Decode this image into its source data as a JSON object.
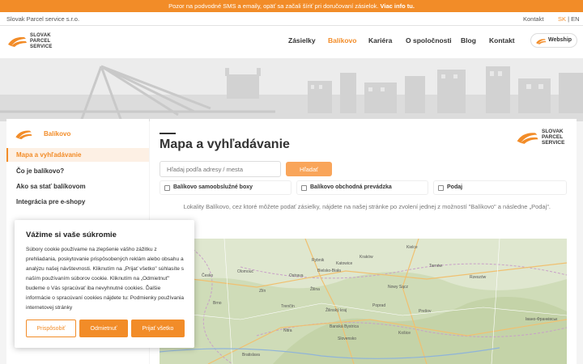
{
  "alert": {
    "text": "Pozor na podvodné SMS a emaily, opäť sa začali šíriť pri doručovaní zásielok.",
    "link": "Viac info tu."
  },
  "topbar": {
    "company": "Slovak Parcel service s.r.o.",
    "contact": "Kontakt",
    "lang_sk": "SK",
    "lang_sep": " | ",
    "lang_en": "EN"
  },
  "header": {
    "logo_lines": [
      "SLOVAK",
      "PARCEL",
      "SERVICE"
    ],
    "nav": [
      "Zásielky",
      "Balíkovo",
      "Kariéra",
      "O spoločnosti",
      "Blog",
      "Kontakt"
    ],
    "active_nav": "Balíkovo",
    "webshop": "Webship"
  },
  "sidebar": {
    "title": "Balíkovo",
    "items": [
      "Mapa a vyhľadávanie",
      "Čo je balíkovo?",
      "Ako sa stať balíkovom",
      "Integrácia pre e-shopy"
    ]
  },
  "main": {
    "title": "Mapa a vyhľadávanie",
    "search_placeholder": "Hľadaj podľa adresy / mesta",
    "search_button": "Hľadať",
    "filters": [
      "Balíkovo samoobslužné boxy",
      "Balíkovo obchodná prevádzka",
      "Podaj"
    ],
    "info": "Lokality Balíkovo, cez ktoré môžete podať zásielky, nájdete na našej stránke po zvolení jednej z možností \"Balíkovo\" a následne „Podaj\"."
  },
  "map": {
    "labels": [
      "Kraków",
      "Rybnik",
      "Bielsko-Biała",
      "Tarnów",
      "Olomouc",
      "Žilina",
      "Nowy Sącz",
      "Česko",
      "Zlín",
      "Poprad",
      "Prešov",
      "Brno",
      "Trenčín",
      "Košice",
      "Banská Bystrica",
      "Žilinský kraj",
      "Nitra",
      "Slovensko",
      "Bratislava",
      "Rzeszów",
      "Ostrava",
      "Kielce",
      "Katowice",
      "Івано-Франківськ"
    ]
  },
  "cookie": {
    "title": "Vážime si vaše súkromie",
    "body": "Súbory cookie používame na zlepšenie vášho zážitku z prehliadania, poskytovanie prispôsobených reklám alebo obsahu a analýzu našej návštevnosti. Kliknutím na „Prijať všetko\" súhlasíte s naším používaním súborov cookie. Kliknutím na „Odmietnuť\" budeme o Vás spracúvať iba nevyhnutné cookies. Ďalšie informácie o spracúvaní cookies nájdete tu: Podmienky používania internetovej stránky",
    "buttons": [
      "Prispôsobiť",
      "Odmietnuť",
      "Prijať všetko"
    ]
  },
  "colors": {
    "brand": "#f28c28",
    "brand_light": "#f9a55a",
    "text": "#333333",
    "bg": "#f4f4f4"
  },
  "icons": [
    "sps-logo-icon",
    "checkbox-icon",
    "webship-icon"
  ]
}
